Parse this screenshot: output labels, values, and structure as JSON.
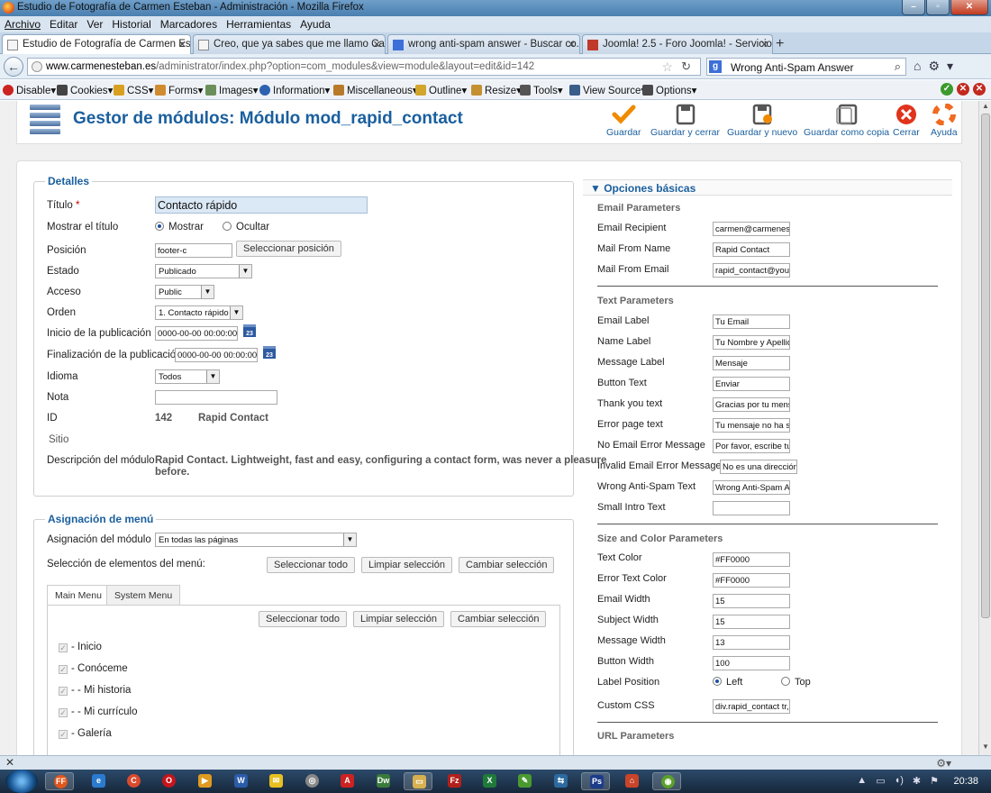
{
  "window": {
    "title": "Estudio de Fotografía de Carmen Esteban - Administración - Mozilla Firefox",
    "controls": [
      "–",
      "▫",
      "✕"
    ]
  },
  "menu": [
    "Archivo",
    "Editar",
    "Ver",
    "Historial",
    "Marcadores",
    "Herramientas",
    "Ayuda"
  ],
  "tabs": [
    {
      "label": "Estudio de Fotografía de Carmen Este..."
    },
    {
      "label": "Creo, que ya sabes que me llamo Car..."
    },
    {
      "label": "wrong anti-spam answer - Buscar co..."
    },
    {
      "label": "Joomla! 2.5 - Foro Joomla! - Servicios ..."
    }
  ],
  "nav": {
    "url_host": "www.carmenesteban.es",
    "url_path": "/administrator/index.php?option=com_modules&view=module&layout=edit&id=142",
    "search": "Wrong Anti-Spam Answer"
  },
  "devbar": [
    "Disable",
    "Cookies",
    "CSS",
    "Forms",
    "Images",
    "Information",
    "Miscellaneous",
    "Outline",
    "Resize",
    "Tools",
    "View Source",
    "Options"
  ],
  "header": {
    "title": "Gestor de módulos: Módulo mod_rapid_contact",
    "buttons": [
      "Guardar",
      "Guardar y cerrar",
      "Guardar y nuevo",
      "Guardar como copia",
      "Cerrar",
      "Ayuda"
    ]
  },
  "details": {
    "legend": "Detalles",
    "title_label": "Título",
    "title_value": "Contacto rápido",
    "show_title_label": "Mostrar el título",
    "show": "Mostrar",
    "hide": "Ocultar",
    "position_label": "Posición",
    "position_value": "footer-c",
    "position_button": "Seleccionar posición",
    "state_label": "Estado",
    "state_value": "Publicado",
    "access_label": "Acceso",
    "access_value": "Public",
    "order_label": "Orden",
    "order_value": "1. Contacto rápido",
    "publish_up_label": "Inicio de la publicación",
    "publish_up_value": "0000-00-00 00:00:00",
    "publish_down_label": "Finalización de la publicación",
    "publish_down_value": "0000-00-00 00:00:00",
    "calendar_glyph": "23",
    "language_label": "Idioma",
    "language_value": "Todos",
    "note_label": "Nota",
    "note_value": "",
    "id_label": "ID",
    "id_value": "142",
    "module_name": "Rapid Contact",
    "site_label": "Sitio",
    "desc_label": "Descripción del módulo",
    "desc_line1": "Rapid Contact. Lightweight, fast and easy, configuring a contact form, was never a pleasure",
    "desc_line2": "before."
  },
  "menu_assignment": {
    "legend": "Asignación de menú",
    "module_assign_label": "Asignación del módulo",
    "module_assign_value": "En todas las páginas",
    "selection_label": "Selección de elementos del menú:",
    "select_all": "Seleccionar todo",
    "clear": "Limpiar selección",
    "toggle": "Cambiar selección",
    "tabs": [
      "Main Menu",
      "System Menu"
    ],
    "items": [
      "- Inicio",
      "- Conóceme",
      "- - Mi historia",
      "- - Mi currículo",
      "- Galería"
    ]
  },
  "options": {
    "header": "Opciones básicas",
    "email_section": "Email Parameters",
    "email_rows": [
      {
        "label": "Email Recipient",
        "value": "carmen@carmenesteban.es"
      },
      {
        "label": "Mail From Name",
        "value": "Rapid Contact"
      },
      {
        "label": "Mail From Email",
        "value": "rapid_contact@yoursite.com"
      }
    ],
    "text_section": "Text Parameters",
    "text_rows": [
      {
        "label": "Email Label",
        "value": "Tu Email"
      },
      {
        "label": "Name Label",
        "value": "Tu Nombre y Apellidos"
      },
      {
        "label": "Message Label",
        "value": "Mensaje"
      },
      {
        "label": "Button Text",
        "value": "Enviar"
      },
      {
        "label": "Thank you text",
        "value": "Gracias por tu mensaje"
      },
      {
        "label": "Error page text",
        "value": "Tu mensaje no ha sido enviado"
      },
      {
        "label": "No Email Error Message",
        "value": "Por favor, escribe tu email"
      },
      {
        "label": "Invalid Email Error Message",
        "value": "No es una dirección válida"
      },
      {
        "label": "Wrong Anti-Spam Text",
        "value": "Wrong Anti-Spam Answer"
      },
      {
        "label": "Small Intro Text",
        "value": ""
      }
    ],
    "size_section": "Size and Color Parameters",
    "size_rows": [
      {
        "label": "Text Color",
        "value": "#FF0000"
      },
      {
        "label": "Error Text Color",
        "value": "#FF0000"
      },
      {
        "label": "Email Width",
        "value": "15"
      },
      {
        "label": "Subject Width",
        "value": "15"
      },
      {
        "label": "Message Width",
        "value": "13"
      },
      {
        "label": "Button Width",
        "value": "100"
      }
    ],
    "label_position_label": "Label Position",
    "left": "Left",
    "top": "Top",
    "custom_css_label": "Custom CSS",
    "custom_css_value": "div.rapid_contact tr, div.rapid_contact td",
    "url_section": "URL Parameters"
  },
  "taskbar": {
    "time": "20:38",
    "apps": [
      "FF",
      "e",
      "C",
      "O",
      "▶",
      "W",
      "✉",
      "◎",
      "A",
      "Dw",
      "▭",
      "Fz",
      "X",
      "✎",
      "⇆",
      "Ps",
      "⌂",
      "◉"
    ]
  }
}
